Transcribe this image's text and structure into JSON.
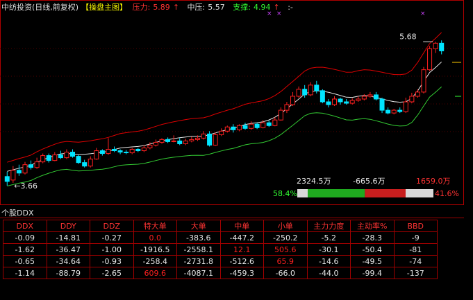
{
  "header": {
    "title": "中纺投资(日线,前复权)",
    "sub": "【操盘主图】",
    "pressure_label": "压力:",
    "pressure_value": "5.89",
    "pressure_arrow": "↑",
    "mid_label": "中压:",
    "mid_value": "5.57",
    "support_label": "支撑:",
    "support_value": "4.94",
    "support_arrow": "↑",
    "tail": ":-"
  },
  "annotations": {
    "high_price": "5.68",
    "low_price": "3.66",
    "x_mark": "×"
  },
  "flow_bar": {
    "inflow": "2324.5万",
    "net": "-665.6万",
    "outflow": "1659.0万",
    "left_pct": "58.4%",
    "right_pct": "41.6%",
    "green_ratio": 0.584,
    "red_ratio": 0.416
  },
  "colors": {
    "up": "#ff2020",
    "down": "#00e5ff",
    "upper_band": "#e00000",
    "lower_band": "#33cc33",
    "mid_line": "#e8e8e8"
  },
  "panel": {
    "title": "个股DDX",
    "headers": [
      "DDX",
      "DDY",
      "DDZ",
      "特大单",
      "大单",
      "中单",
      "小单",
      "主力力度",
      "主动率%",
      "BBD"
    ],
    "rows": [
      [
        "-0.09",
        "-14.81",
        "-0.27",
        "0.0",
        "-383.6",
        "-447.2",
        "-250.2",
        "-5.2",
        "-28.3",
        "-9"
      ],
      [
        "-1.62",
        "-36.47",
        "-1.00",
        "-1916.5",
        "-2558.1",
        "12.1",
        "505.6",
        "-30.1",
        "-50.4",
        "-81"
      ],
      [
        "-0.65",
        "-34.64",
        "-0.93",
        "-258.4",
        "-2731.8",
        "-512.6",
        "65.9",
        "-14.6",
        "-49.5",
        "-74"
      ],
      [
        "-1.14",
        "-88.79",
        "-2.65",
        "609.6",
        "-4087.1",
        "-459.3",
        "-66.0",
        "-44.0",
        "-99.4",
        "-137"
      ]
    ],
    "row_colors": [
      [
        "cw",
        "cw",
        "cw",
        "cr",
        "cw",
        "cw",
        "cw",
        "cw",
        "cw",
        "cw"
      ],
      [
        "cw",
        "cw",
        "cw",
        "cw",
        "cw",
        "cr",
        "cr",
        "cw",
        "cw",
        "cw"
      ],
      [
        "cw",
        "cw",
        "cw",
        "cw",
        "cw",
        "cw",
        "cr",
        "cw",
        "cw",
        "cw"
      ],
      [
        "cw",
        "cw",
        "cw",
        "cr",
        "cw",
        "cw",
        "cw",
        "cw",
        "cw",
        "cw"
      ]
    ]
  },
  "chart_data": {
    "type": "candlestick",
    "price_range": [
      3.5,
      6.1
    ],
    "candles": [
      [
        3.75,
        3.68,
        3.82,
        3.62
      ],
      [
        3.7,
        3.84,
        3.9,
        3.66
      ],
      [
        3.84,
        3.8,
        3.92,
        3.76
      ],
      [
        3.8,
        3.92,
        3.96,
        3.78
      ],
      [
        3.92,
        3.88,
        3.98,
        3.85
      ],
      [
        3.88,
        3.96,
        4.02,
        3.86
      ],
      [
        3.96,
        4.05,
        4.08,
        3.94
      ],
      [
        4.05,
        3.98,
        4.08,
        3.95
      ],
      [
        3.98,
        4.06,
        4.1,
        3.97
      ],
      [
        4.06,
        4.02,
        4.12,
        4.0
      ],
      [
        4.02,
        4.1,
        4.14,
        4.0
      ],
      [
        4.1,
        4.04,
        4.14,
        4.02
      ],
      [
        4.04,
        3.95,
        4.06,
        3.93
      ],
      [
        3.95,
        3.9,
        3.99,
        3.88
      ],
      [
        3.9,
        4.0,
        4.04,
        3.88
      ],
      [
        4.0,
        4.12,
        4.16,
        3.99
      ],
      [
        4.12,
        4.08,
        4.14,
        4.05
      ],
      [
        4.08,
        4.14,
        4.3,
        4.06
      ],
      [
        4.14,
        4.12,
        4.18,
        4.1
      ],
      [
        4.12,
        4.1,
        4.14,
        4.07
      ],
      [
        4.1,
        4.09,
        4.13,
        4.07
      ],
      [
        4.09,
        4.14,
        4.16,
        4.07
      ],
      [
        4.14,
        4.12,
        4.16,
        4.1
      ],
      [
        4.12,
        4.16,
        4.2,
        4.1
      ],
      [
        4.16,
        4.2,
        4.24,
        4.14
      ],
      [
        4.2,
        4.24,
        4.28,
        4.18
      ],
      [
        4.24,
        4.28,
        4.3,
        4.22
      ],
      [
        4.28,
        4.25,
        4.31,
        4.23
      ],
      [
        4.25,
        4.26,
        4.34,
        4.24
      ],
      [
        4.26,
        4.22,
        4.3,
        4.2
      ],
      [
        4.22,
        4.26,
        4.29,
        4.2
      ],
      [
        4.26,
        4.28,
        4.32,
        4.24
      ],
      [
        4.28,
        4.3,
        4.34,
        4.26
      ],
      [
        4.3,
        4.36,
        4.4,
        4.28
      ],
      [
        4.36,
        4.2,
        4.4,
        4.18
      ],
      [
        4.2,
        4.35,
        4.38,
        4.19
      ],
      [
        4.35,
        4.4,
        4.44,
        4.33
      ],
      [
        4.4,
        4.46,
        4.48,
        4.38
      ],
      [
        4.46,
        4.42,
        4.5,
        4.38
      ],
      [
        4.42,
        4.48,
        4.5,
        4.4
      ],
      [
        4.48,
        4.44,
        4.52,
        4.42
      ],
      [
        4.44,
        4.5,
        4.54,
        4.42
      ],
      [
        4.5,
        4.45,
        4.52,
        4.43
      ],
      [
        4.45,
        4.52,
        4.56,
        4.44
      ],
      [
        4.52,
        4.48,
        4.55,
        4.46
      ],
      [
        4.48,
        4.56,
        4.6,
        4.47
      ],
      [
        4.56,
        4.7,
        4.74,
        4.55
      ],
      [
        4.7,
        4.78,
        4.82,
        4.66
      ],
      [
        4.78,
        4.9,
        4.96,
        4.76
      ],
      [
        4.9,
        5.0,
        5.04,
        4.88
      ],
      [
        5.0,
        4.92,
        5.06,
        4.88
      ],
      [
        4.92,
        5.06,
        5.1,
        4.9
      ],
      [
        5.06,
        4.98,
        5.12,
        4.94
      ],
      [
        4.98,
        4.82,
        5.0,
        4.8
      ],
      [
        4.82,
        4.78,
        4.86,
        4.74
      ],
      [
        4.78,
        4.86,
        4.9,
        4.76
      ],
      [
        4.86,
        4.82,
        4.88,
        4.78
      ],
      [
        4.82,
        4.8,
        4.86,
        4.78
      ],
      [
        4.8,
        4.84,
        4.87,
        4.78
      ],
      [
        4.84,
        4.86,
        4.9,
        4.82
      ],
      [
        4.86,
        4.9,
        4.93,
        4.84
      ],
      [
        4.9,
        4.92,
        4.96,
        4.88
      ],
      [
        4.92,
        4.86,
        4.96,
        4.84
      ],
      [
        4.86,
        4.7,
        4.88,
        4.66
      ],
      [
        4.7,
        4.66,
        4.74,
        4.64
      ],
      [
        4.66,
        4.7,
        4.72,
        4.64
      ],
      [
        4.7,
        4.68,
        4.74,
        4.66
      ],
      [
        4.68,
        4.82,
        4.88,
        4.66
      ],
      [
        4.82,
        4.9,
        4.95,
        4.8
      ],
      [
        4.9,
        4.96,
        5.0,
        4.88
      ],
      [
        4.96,
        5.28,
        5.32,
        4.94
      ],
      [
        5.28,
        5.58,
        5.62,
        5.26
      ],
      [
        5.58,
        5.66,
        5.68,
        5.52
      ],
      [
        5.66,
        5.55,
        5.7,
        5.5
      ]
    ]
  }
}
